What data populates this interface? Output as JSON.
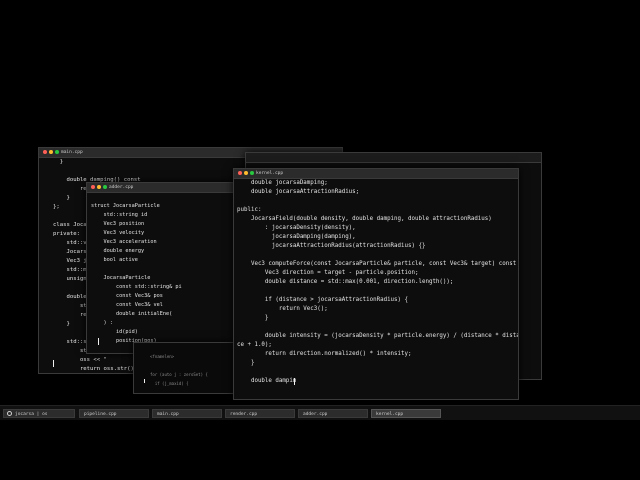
{
  "colors": {
    "dot_close": "#ff5f57",
    "dot_min": "#febc2e",
    "dot_max": "#28c840"
  },
  "windows": {
    "main": {
      "title": "main.cpp",
      "lines": [
        "  }",
        "",
        "    double damping() const",
        "        return f",
        "    }",
        "};",
        "",
        "class JocarsaWo",
        "private:",
        "    std::vector<",
        "    JocarsaField",
        "    Vec3 jocarsa",
        "    std::mt19937",
        "    unsigned lon",
        "",
        "    double rando",
        "        std::uni",
        "        return d",
        "    }",
        "",
        "    std::string",
        "        std::ost",
        "        oss << \"",
        "        return oss.str()"
      ]
    },
    "adder": {
      "title": "adder.cpp",
      "lines": [
        "",
        "struct JocarsaParticle",
        "    std::string id",
        "    Vec3 position",
        "    Vec3 velocity",
        "    Vec3 acceleration",
        "    double energy",
        "    bool active",
        "",
        "    JocarsaParticle",
        "        const std::string& pi",
        "        const Vec3& pos",
        "        const Vec3& vel",
        "        double initialEne(",
        "    ) :",
        "        id(pid)",
        "        position(pos)"
      ]
    },
    "ghost2": {
      "lines": [
        "",
        "<fnamelen>",
        "",
        "for (auto j : zeroSet) {",
        "  if (j_maxid) {"
      ]
    },
    "kernel": {
      "title": "kernel.cpp",
      "lines": [
        "    double jocarsaDamping;",
        "    double jocarsaAttractionRadius;",
        "",
        "public:",
        "    JocarsaField(double density, double damping, double attractionRadius)",
        "        : jocarsaDensity(density),",
        "          jocarsaDamping(damping),",
        "          jocarsaAttractionRadius(attractionRadius) {}",
        "",
        "    Vec3 computeForce(const JocarsaParticle& particle, const Vec3& target) const {",
        "        Vec3 direction = target - particle.position;",
        "        double distance = std::max(0.001, direction.length());",
        "",
        "        if (distance > jocarsaAttractionRadius) {",
        "            return Vec3();",
        "        }",
        "",
        "        double intensity = (jocarsaDensity * particle.energy) / (distance * distan",
        "ce + 1.0);",
        "        return direction.normalized() * intensity;",
        "    }",
        "",
        "    double dampin"
      ]
    }
  },
  "taskbar": {
    "start_label": "jocarsa | os",
    "tasks": [
      "pipeline.cpp",
      "main.cpp",
      "render.cpp",
      "adder.cpp",
      "kernel.cpp"
    ]
  }
}
